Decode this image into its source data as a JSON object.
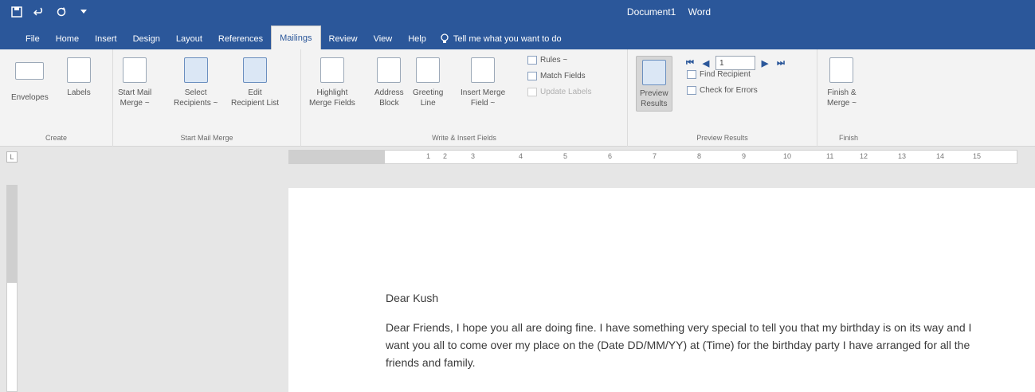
{
  "window": {
    "doc_title": "Document1",
    "app_name": "Word"
  },
  "qat": {
    "save_icon": "save-icon",
    "undo_icon": "undo-icon",
    "redo_icon": "redo-icon"
  },
  "tabs": [
    "File",
    "Home",
    "Insert",
    "Design",
    "Layout",
    "References",
    "Mailings",
    "Review",
    "View",
    "Help"
  ],
  "active_tab": "Mailings",
  "tell_me": "Tell me what you want to do",
  "ribbon": {
    "create": {
      "label": "Create",
      "envelopes": "Envelopes",
      "labels": "Labels"
    },
    "start_mail_merge": {
      "label": "Start Mail Merge",
      "start_line1": "Start Mail",
      "start_line2": "Merge ~",
      "select_line1": "Select",
      "select_line2": "Recipients ~",
      "edit_line1": "Edit",
      "edit_line2": "Recipient List"
    },
    "write_insert": {
      "label": "Write & Insert Fields",
      "highlight_line1": "Highlight",
      "highlight_line2": "Merge Fields",
      "address_line1": "Address",
      "address_line2": "Block",
      "greeting_line1": "Greeting",
      "greeting_line2": "Line",
      "insert_line1": "Insert Merge",
      "insert_line2": "Field ~",
      "rules": "Rules ~",
      "match_fields": "Match Fields",
      "update_labels": "Update Labels"
    },
    "preview": {
      "label": "Preview Results",
      "preview_line1": "Preview",
      "preview_line2": "Results",
      "record_value": "1",
      "find_recipient": "Find Recipient",
      "check_errors": "Check for Errors"
    },
    "finish": {
      "label": "Finish",
      "finish_line1": "Finish &",
      "finish_line2": "Merge ~"
    }
  },
  "ruler": {
    "ticks": [
      "1",
      "2",
      "3",
      "4",
      "5",
      "6",
      "7",
      "8",
      "9",
      "10",
      "11",
      "12",
      "13",
      "14",
      "15"
    ]
  },
  "document": {
    "greeting": "Dear Kush",
    "body": "Dear Friends, I hope you all are doing fine. I have something very special to tell you that my birthday is on its way and I want you all to come over my place on the (Date DD/MM/YY) at (Time) for the birthday party I have arranged for all the friends and family."
  }
}
